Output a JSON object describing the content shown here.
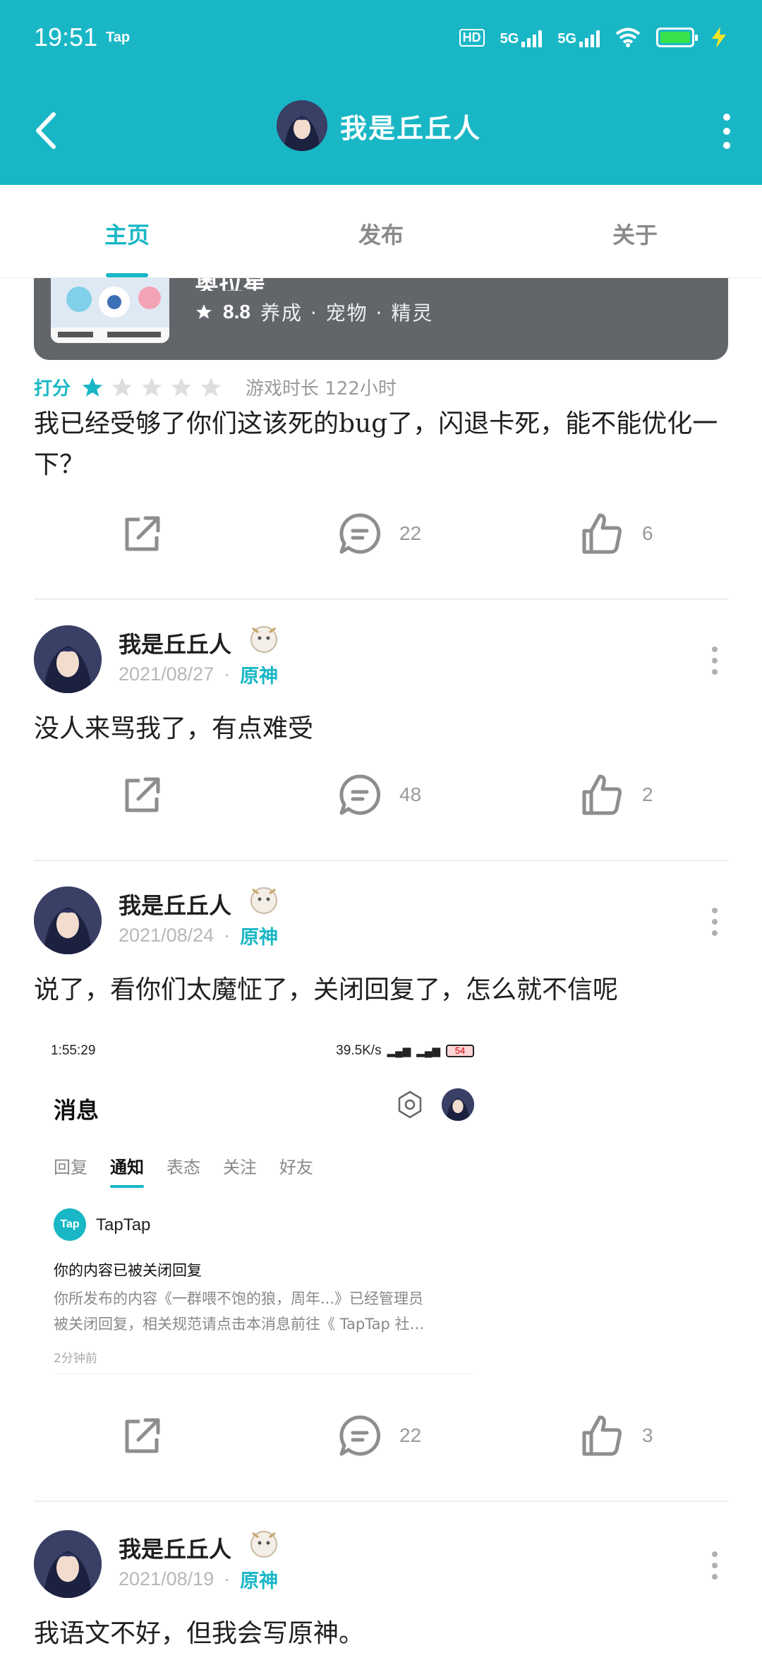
{
  "status_bar": {
    "time": "19:51",
    "app_badge": "Tap",
    "network_1": "5G",
    "network_2": "5G",
    "hd_label": "HD"
  },
  "nav": {
    "title": "我是丘丘人"
  },
  "tabs": [
    {
      "label": "主页",
      "active": true
    },
    {
      "label": "发布",
      "active": false
    },
    {
      "label": "关于",
      "active": false
    }
  ],
  "game_card": {
    "name": "奥拉星",
    "score": "8.8",
    "tags": "养成 · 宠物 · 精灵"
  },
  "first_post": {
    "rating_label": "打分",
    "stars_filled": 1,
    "stars_total": 5,
    "play_time": "游戏时长 122小时",
    "text": "我已经受够了你们这该死的bug了，闪退卡死，能不能优化一下？",
    "comments": "22",
    "likes": "6"
  },
  "posts": [
    {
      "author": "我是丘丘人",
      "date": "2021/08/27",
      "separator": "·",
      "game": "原神",
      "text": "没人来骂我了，有点难受",
      "comments": "48",
      "likes": "2"
    },
    {
      "author": "我是丘丘人",
      "date": "2021/08/24",
      "separator": "·",
      "game": "原神",
      "text": "说了，看你们太魔怔了，关闭回复了，怎么就不信呢",
      "comments": "22",
      "likes": "3"
    },
    {
      "author": "我是丘丘人",
      "date": "2021/08/19",
      "separator": "·",
      "game": "原神",
      "text": "我语文不好，但我会写原神。"
    }
  ],
  "embedded_screenshot": {
    "time": "1:55:29",
    "speed": "39.5K/s",
    "battery": "54",
    "title": "消息",
    "tabs": [
      "回复",
      "通知",
      "表态",
      "关注",
      "好友"
    ],
    "active_tab": "通知",
    "logo_text": "Tap",
    "sender": "TapTap",
    "headline": "你的内容已被关闭回复",
    "body_line1": "你所发布的内容《一群喂不饱的狼，周年...》已经管理员",
    "body_line2": "被关闭回复，相关规范请点击本消息前往《 TapTap 社…",
    "when": "2分钟前"
  },
  "colors": {
    "brand": "#19b7c6",
    "header_bg": "#19b7c6",
    "card_bg": "#62666b",
    "muted": "#9a9a9a"
  },
  "icons": [
    "back-arrow-icon",
    "more-vertical-icon",
    "share-icon",
    "comment-icon",
    "thumbs-up-icon",
    "star-icon",
    "gear-icon",
    "wifi-icon",
    "battery-icon"
  ]
}
